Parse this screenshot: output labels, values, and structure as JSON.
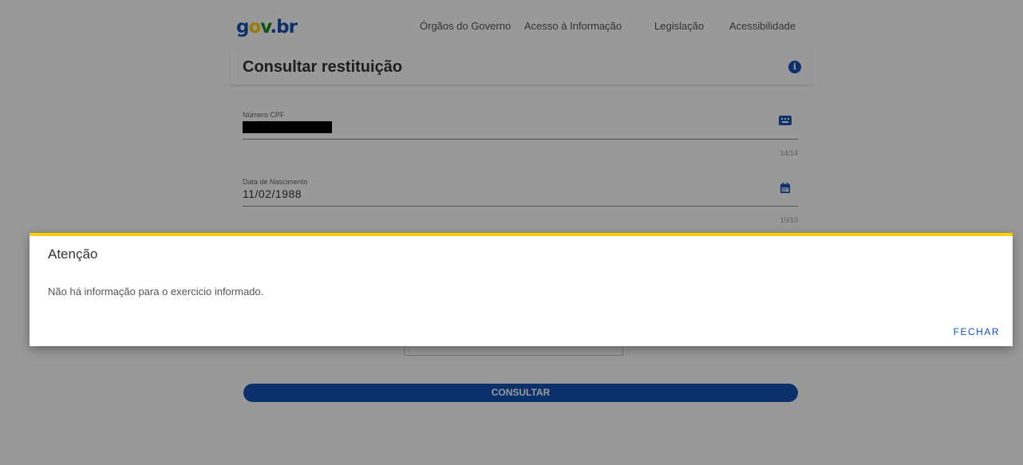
{
  "header": {
    "logo": {
      "g": "g",
      "o": "o",
      "v": "v",
      "dot": ".",
      "b": "b",
      "r": "r"
    },
    "nav": [
      "Órgãos do Governo",
      "Acesso à Informação",
      "Legislação",
      "Acessibilidade"
    ]
  },
  "page": {
    "title": "Consultar restituição",
    "info_icon": "i"
  },
  "form": {
    "cpf": {
      "label": "Número CPF",
      "value": "",
      "counter": "14/14",
      "icon": "keyboard-icon"
    },
    "birth": {
      "label": "Data de Nascimento",
      "value": "11/02/1988",
      "counter": "10/10",
      "icon": "calendar-icon"
    },
    "submit_label": "CONSULTAR"
  },
  "dialog": {
    "title": "Atenção",
    "message": "Não há informação para o exercicio informado.",
    "close_label": "FECHAR"
  },
  "colors": {
    "primary": "#1351b4",
    "accent": "#ffcd07",
    "green": "#168821"
  }
}
